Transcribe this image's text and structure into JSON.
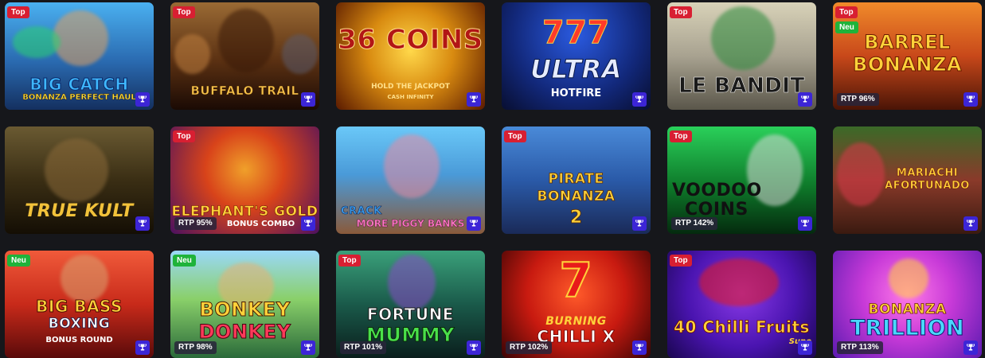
{
  "tiles": [
    {
      "id": "big-catch",
      "title_line1": "BIG CATCH",
      "title_line2": "BONANZA PERFECT HAUL",
      "top_badge": "Top",
      "second_badge": "",
      "rtp": "",
      "bg": [
        "#3fa0e0",
        "#1b3a6a"
      ],
      "title_color": "#3fb8ff",
      "sub_color": "#ffe23a"
    },
    {
      "id": "buffalo-trail",
      "title_line1": "BUFFALO TRAIL",
      "title_line2": "",
      "top_badge": "Top",
      "second_badge": "",
      "rtp": "",
      "bg": [
        "#8a5a2a",
        "#241006"
      ],
      "title_color": "#f6c24a",
      "sub_color": "#ffffff"
    },
    {
      "id": "36-coins",
      "title_line1": "36 COINS",
      "title_line2": "HOLD THE JACKPOT",
      "sub_line3": "CASH INFINITY",
      "top_badge": "",
      "second_badge": "",
      "rtp": "",
      "bg": [
        "#d8a11a",
        "#6a2a00"
      ],
      "title_color": "#b21616",
      "sub_color": "#ffe08a"
    },
    {
      "id": "ultra-hotfire",
      "title_line1": "777",
      "title_line2": "ULTRA",
      "sub_line3": "HOTFIRE",
      "top_badge": "",
      "second_badge": "",
      "rtp": "",
      "bg": [
        "#1d3fb8",
        "#0b1540"
      ],
      "title_color": "#ff3a2a",
      "sub_color": "#ffffff"
    },
    {
      "id": "le-bandit",
      "title_line1": "LE BANDIT",
      "title_line2": "",
      "top_badge": "Top",
      "second_badge": "",
      "rtp": "",
      "bg": [
        "#c9c2a8",
        "#6e6a5a"
      ],
      "title_color": "#1a1a1a",
      "sub_color": "#ffffff"
    },
    {
      "id": "barrel-bonanza",
      "title_line1": "BARREL",
      "title_line2": "BONANZA",
      "top_badge": "Top",
      "second_badge": "Neu",
      "rtp": "RTP 96%",
      "bg": [
        "#e76a1a",
        "#5a1a08"
      ],
      "title_color": "#ffd23a",
      "sub_color": "#ffd23a"
    },
    {
      "id": "true-kult",
      "title_line1": "TRUE KULT",
      "title_line2": "",
      "top_badge": "",
      "second_badge": "",
      "rtp": "",
      "bg": [
        "#5a4a28",
        "#1a1408"
      ],
      "title_color": "#f2c23a",
      "sub_color": "#ffffff"
    },
    {
      "id": "elephants-gold",
      "title_line1": "ELEPHANT'S GOLD",
      "title_line2": "BONUS COMBO",
      "top_badge": "Top",
      "second_badge": "",
      "rtp": "RTP 95%",
      "bg": [
        "#e0431a",
        "#5a1a6a"
      ],
      "title_color": "#ffd23a",
      "sub_color": "#ffffff"
    },
    {
      "id": "crack-piggy",
      "title_line1": "CRACK",
      "title_line2": "MORE PIGGY BANKS",
      "top_badge": "",
      "second_badge": "",
      "rtp": "",
      "bg": [
        "#5ac0f0",
        "#2a6aa8"
      ],
      "title_color": "#3a9ae8",
      "sub_color": "#ff7ac8"
    },
    {
      "id": "pirate-bonanza-2",
      "title_line1": "PIRATE",
      "title_line2": "BONANZA",
      "sub_line3": "2",
      "top_badge": "Top",
      "second_badge": "",
      "rtp": "",
      "bg": [
        "#3a7ac8",
        "#1a2a58"
      ],
      "title_color": "#ffd23a",
      "sub_color": "#ffd23a"
    },
    {
      "id": "voodoo-coins",
      "title_line1": "VOODOO",
      "title_line2": "COINS",
      "top_badge": "Top",
      "second_badge": "",
      "rtp": "RTP 142%",
      "bg": [
        "#1ab84a",
        "#063a16"
      ],
      "title_color": "#1a1a1a",
      "sub_color": "#1a1a1a"
    },
    {
      "id": "mariachi-afortunado",
      "title_line1": "MARIACHI",
      "title_line2": "AFORTUNADO",
      "top_badge": "",
      "second_badge": "",
      "rtp": "",
      "bg": [
        "#c83a2a",
        "#2a4a18"
      ],
      "title_color": "#ffd23a",
      "sub_color": "#ffd23a"
    },
    {
      "id": "big-bass-boxing",
      "title_line1": "BIG BASS",
      "title_line2": "BOXING",
      "sub_line3": "BONUS ROUND",
      "top_badge": "Neu",
      "second_badge": "",
      "rtp": "",
      "bg": [
        "#e0402a",
        "#6a1010"
      ],
      "title_color": "#ffd23a",
      "sub_color": "#ffffff"
    },
    {
      "id": "bonkey-donkey",
      "title_line1": "BONKEY",
      "title_line2": "DONKEY",
      "top_badge": "Neu",
      "second_badge": "",
      "rtp": "RTP 98%",
      "bg": [
        "#8ad06a",
        "#2a6a3a"
      ],
      "title_color": "#ffd23a",
      "sub_color": "#ff3a5a"
    },
    {
      "id": "fortune-mummy",
      "title_line1": "FORTUNE",
      "title_line2": "MUMMY",
      "top_badge": "Top",
      "second_badge": "",
      "rtp": "RTP 101%",
      "bg": [
        "#2a8a6a",
        "#0e2a28"
      ],
      "title_color": "#ffffff",
      "sub_color": "#4ae04a"
    },
    {
      "id": "burning-chilli-x",
      "title_line1": "BURNING",
      "title_line2": "CHILLI X",
      "top_badge": "",
      "second_badge": "",
      "rtp": "RTP 102%",
      "bg": [
        "#d82a1a",
        "#4a0606"
      ],
      "title_color": "#ffd23a",
      "sub_color": "#ffffff"
    },
    {
      "id": "40-chilli-fruits",
      "title_line1": "40 Chilli Fruits",
      "title_line2": "Supe",
      "top_badge": "Top",
      "second_badge": "",
      "rtp": "",
      "bg": [
        "#7a2ad8",
        "#2a0a6a"
      ],
      "title_color": "#ffd23a",
      "sub_color": "#ffd23a"
    },
    {
      "id": "bonanza-trillion",
      "title_line1": "BONANZA",
      "title_line2": "TRILLION",
      "top_badge": "",
      "second_badge": "",
      "rtp": "RTP 113%",
      "bg": [
        "#e04ad8",
        "#6a1ab8"
      ],
      "title_color": "#ffd23a",
      "sub_color": "#4ad8ff"
    }
  ],
  "colors": {
    "page_bg": "#16171b",
    "fav_button": "#3c25d6",
    "top_badge": "#d81f32",
    "neu_badge": "#1fb33a"
  },
  "fav_icon": "trophy-icon"
}
